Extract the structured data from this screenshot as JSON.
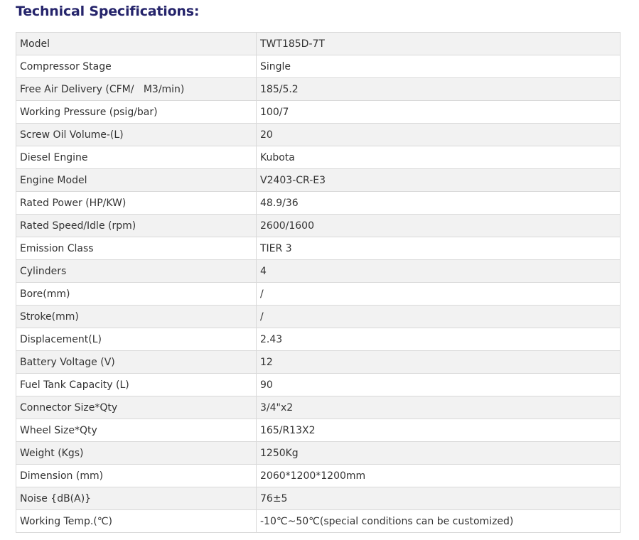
{
  "section": {
    "title": "Technical Specifications:"
  },
  "specs": [
    {
      "label": "Model",
      "value": "TWT185D-7T"
    },
    {
      "label": "Compressor Stage",
      "value": "Single"
    },
    {
      "label": "Free Air Delivery (CFM/   M3/min)",
      "value": "185/5.2"
    },
    {
      "label": "Working Pressure (psig/bar)",
      "value": "100/7"
    },
    {
      "label": "Screw Oil Volume-(L)",
      "value": "20"
    },
    {
      "label": "Diesel Engine",
      "value": "Kubota"
    },
    {
      "label": "Engine Model",
      "value": "V2403-CR-E3"
    },
    {
      "label": "Rated Power (HP/KW)",
      "value": "48.9/36"
    },
    {
      "label": "Rated Speed/Idle (rpm)",
      "value": "2600/1600"
    },
    {
      "label": "Emission Class",
      "value": "TIER 3"
    },
    {
      "label": "Cylinders",
      "value": "4"
    },
    {
      "label": "Bore(mm)",
      "value": "/"
    },
    {
      "label": "Stroke(mm)",
      "value": "/"
    },
    {
      "label": "Displacement(L)",
      "value": "2.43"
    },
    {
      "label": "Battery Voltage (V)",
      "value": "12"
    },
    {
      "label": "Fuel Tank Capacity (L)",
      "value": "90"
    },
    {
      "label": "Connector Size*Qty",
      "value": "3/4\"x2"
    },
    {
      "label": "Wheel Size*Qty",
      "value": "165/R13X2"
    },
    {
      "label": "Weight (Kgs)",
      "value": "1250Kg"
    },
    {
      "label": "Dimension (mm)",
      "value": "2060*1200*1200mm"
    },
    {
      "label": "Noise {dB(A)}",
      "value": "76±5"
    },
    {
      "label": "Working Temp.(℃)",
      "value": "-10℃~50℃(special conditions can be customized)"
    }
  ],
  "colors": {
    "title": "#25246b",
    "text": "#333333",
    "row_alt": "#f2f2f2",
    "border": "#d9d9d9"
  }
}
